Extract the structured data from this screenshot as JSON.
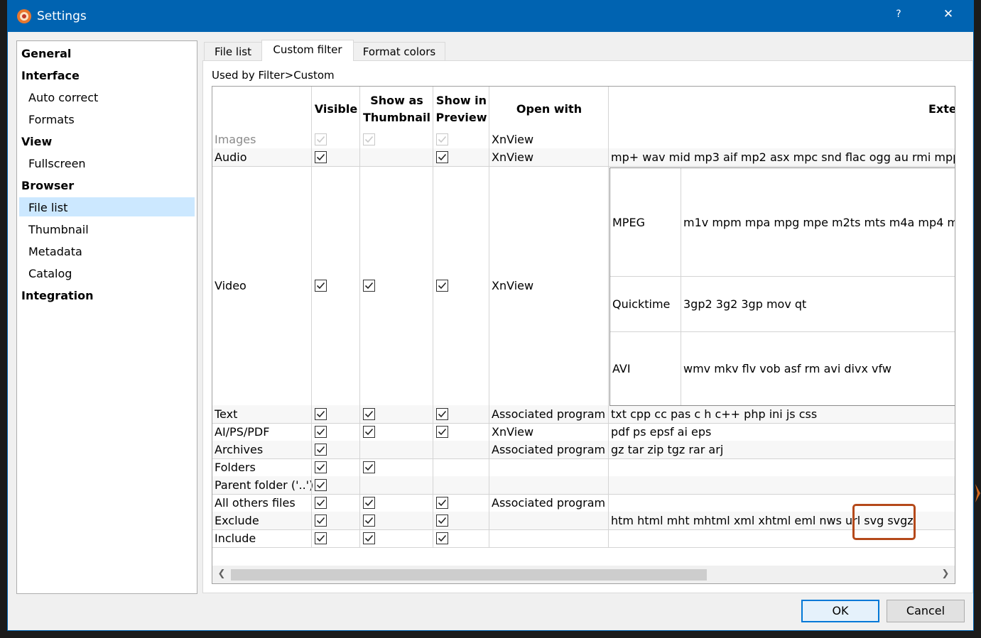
{
  "window": {
    "title": "Settings",
    "help_label": "?",
    "close_label": "✕"
  },
  "sidebar": {
    "items": [
      {
        "label": "General",
        "kind": "category"
      },
      {
        "label": "Interface",
        "kind": "category"
      },
      {
        "label": "Auto correct",
        "kind": "sub"
      },
      {
        "label": "Formats",
        "kind": "sub"
      },
      {
        "label": "View",
        "kind": "category"
      },
      {
        "label": "Fullscreen",
        "kind": "sub"
      },
      {
        "label": "Browser",
        "kind": "category"
      },
      {
        "label": "File list",
        "kind": "sub",
        "selected": true
      },
      {
        "label": "Thumbnail",
        "kind": "sub"
      },
      {
        "label": "Metadata",
        "kind": "sub"
      },
      {
        "label": "Catalog",
        "kind": "sub"
      },
      {
        "label": "Integration",
        "kind": "category"
      }
    ]
  },
  "tabs": [
    {
      "label": "File list"
    },
    {
      "label": "Custom filter",
      "active": true
    },
    {
      "label": "Format colors"
    }
  ],
  "panel": {
    "used_by": "Used by Filter>Custom"
  },
  "table": {
    "headers": {
      "visible": "Visible",
      "thumbnail_1": "Show as",
      "thumbnail_2": "Thumbnail",
      "preview_1": "Show in",
      "preview_2": "Preview",
      "open_with": "Open with",
      "extensions": "Exte"
    },
    "rows": [
      {
        "name": "Images",
        "visible": true,
        "thumbnail": true,
        "preview": true,
        "open_with": "XnView",
        "extensions": "",
        "disabled": true
      },
      {
        "name": "Audio",
        "visible": true,
        "thumbnail": false,
        "preview": true,
        "open_with": "XnView",
        "extensions": "mp+ wav mid mp3 aif mp2 asx mpc snd flac ogg au rmi mpp"
      },
      {
        "name": "Video",
        "visible": true,
        "thumbnail": true,
        "preview": true,
        "open_with": "XnView",
        "extensions": ""
      },
      {
        "name": "Text",
        "visible": true,
        "thumbnail": true,
        "preview": true,
        "open_with": "Associated program",
        "extensions": "txt cpp cc pas c h c++ php ini js css"
      },
      {
        "name": "AI/PS/PDF",
        "visible": true,
        "thumbnail": true,
        "preview": true,
        "open_with": "XnView",
        "extensions": "pdf ps epsf ai eps"
      },
      {
        "name": "Archives",
        "visible": true,
        "thumbnail": false,
        "preview": false,
        "open_with": "Associated program",
        "extensions": "gz tar zip tgz rar arj"
      },
      {
        "name": "Folders",
        "visible": true,
        "thumbnail": true,
        "preview": false,
        "open_with": "",
        "extensions": ""
      },
      {
        "name": "Parent folder ('..')",
        "visible": true,
        "thumbnail": false,
        "preview": false,
        "open_with": "",
        "extensions": ""
      },
      {
        "name": "All others files",
        "visible": true,
        "thumbnail": true,
        "preview": true,
        "open_with": "Associated program",
        "extensions": ""
      },
      {
        "name": "Exclude",
        "visible": true,
        "thumbnail": true,
        "preview": true,
        "open_with": "",
        "extensions": "htm html mht mhtml xml xhtml eml nws url svg svgz"
      },
      {
        "name": "Include",
        "visible": true,
        "thumbnail": true,
        "preview": true,
        "open_with": "",
        "extensions": ""
      }
    ],
    "video_subtypes": [
      {
        "name": "MPEG",
        "extensions": "m1v mpm mpa mpg mpe m2ts mts m4a mp4 m"
      },
      {
        "name": "Quicktime",
        "extensions": "3gp2 3g2 3gp mov qt"
      },
      {
        "name": "AVI",
        "extensions": "wmv mkv flv vob asf rm avi divx vfw"
      }
    ]
  },
  "buttons": {
    "ok": "OK",
    "cancel": "Cancel"
  },
  "colors": {
    "titlebar": "#0063b1",
    "selection": "#cce8ff",
    "highlight_box": "#b5491a"
  }
}
